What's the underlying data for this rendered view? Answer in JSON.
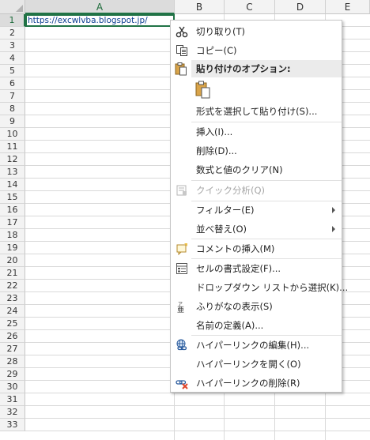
{
  "sheet": {
    "columns": [
      "A",
      "B",
      "C",
      "D",
      "E"
    ],
    "rows": [
      "1",
      "2",
      "3",
      "4",
      "5",
      "6",
      "7",
      "8",
      "9",
      "10",
      "11",
      "12",
      "13",
      "14",
      "15",
      "16",
      "17",
      "18",
      "19",
      "20",
      "21",
      "22",
      "23",
      "24",
      "25",
      "26",
      "27",
      "28",
      "29",
      "30",
      "31",
      "32",
      "33"
    ],
    "cell_a1_value": "https://excwlvba.blogspot.jp/"
  },
  "context_menu": {
    "cut": "切り取り(T)",
    "copy": "コピー(C)",
    "paste_options_header": "貼り付けのオプション:",
    "paste_special": "形式を選択して貼り付け(S)...",
    "insert": "挿入(I)...",
    "delete": "削除(D)...",
    "clear_contents": "数式と値のクリア(N)",
    "quick_analysis": "クイック分析(Q)",
    "filter": "フィルター(E)",
    "sort": "並べ替え(O)",
    "insert_comment": "コメントの挿入(M)",
    "format_cells": "セルの書式設定(F)...",
    "pick_from_list": "ドロップダウン リストから選択(K)...",
    "show_phonetic": "ふりがなの表示(S)",
    "define_name": "名前の定義(A)...",
    "edit_hyperlink": "ハイパーリンクの編集(H)...",
    "open_hyperlink": "ハイパーリンクを開く(O)",
    "remove_hyperlink": "ハイパーリンクの削除(R)"
  },
  "icons": {
    "cut": "scissors-icon",
    "copy": "copy-icon",
    "paste": "clipboard-icon",
    "quick_analysis": "quick-analysis-icon",
    "comment": "comment-icon",
    "format_cells": "format-cells-icon",
    "phonetic": "phonetic-icon",
    "hyperlink": "globe-link-icon",
    "remove_link": "remove-link-icon"
  },
  "colors": {
    "accent": "#217346",
    "link_text": "#0b3e91",
    "remove_x": "#e0452b"
  }
}
